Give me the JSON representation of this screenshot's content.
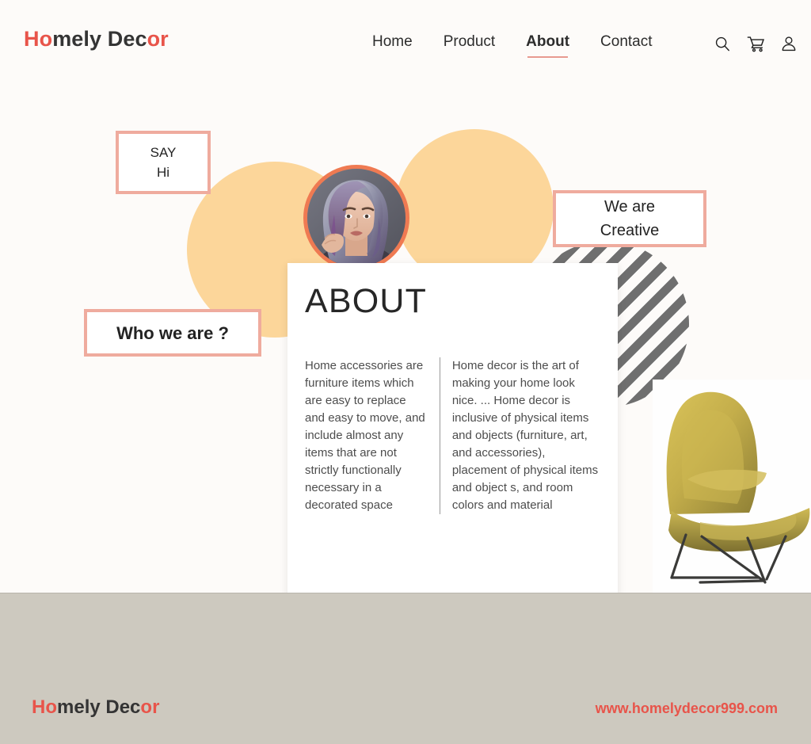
{
  "theme": {
    "page_background": "#fdfbf9",
    "accent_red": "#e8544a",
    "accent_salmon": "#efab9e",
    "accent_orange": "#ef7a52",
    "blob_peach": "#fcd69a",
    "stripe_gray": "#6f6f6f",
    "footer_background": "#cdc9bf",
    "card_white": "#ffffff"
  },
  "header": {
    "logo": {
      "part_accent_1": "Ho",
      "part_dark": "mely Dec",
      "part_accent_2": "or",
      "full_text": "Homely Decor"
    },
    "nav": [
      {
        "label": "Home",
        "active": false
      },
      {
        "label": "Product",
        "active": false
      },
      {
        "label": "About",
        "active": true
      },
      {
        "label": "Contact",
        "active": false
      }
    ],
    "icons": [
      {
        "name": "search-icon",
        "label": "Search"
      },
      {
        "name": "cart-icon",
        "label": "Cart"
      },
      {
        "name": "user-icon",
        "label": "Account"
      }
    ]
  },
  "hero": {
    "tag_say": {
      "line1": "SAY",
      "line2": "Hi"
    },
    "tag_creative": {
      "line1": "We are",
      "line2": "Creative"
    },
    "tag_who": {
      "text": "Who we are ?"
    },
    "avatar": {
      "alt": "Portrait of a woman with violet hair"
    },
    "chair": {
      "alt": "Mustard yellow lounge chair with metal frame"
    }
  },
  "about": {
    "title": "ABOUT",
    "column_left": "Home accessories are furniture items which are easy to replace and easy to move, and include almost any items that are not strictly functionally necessary in a decorated space",
    "column_right": "Home decor is the art of making your home look nice. ... Home decor is inclusive of physical items and objects (furniture, art, and accessories), placement of physical items and object s, and room colors and material"
  },
  "footer": {
    "logo": {
      "part_accent_1": "Ho",
      "part_dark": "mely Dec",
      "part_accent_2": "or",
      "full_text": "Homely Decor"
    },
    "url": "www.homelydecor999.com"
  }
}
